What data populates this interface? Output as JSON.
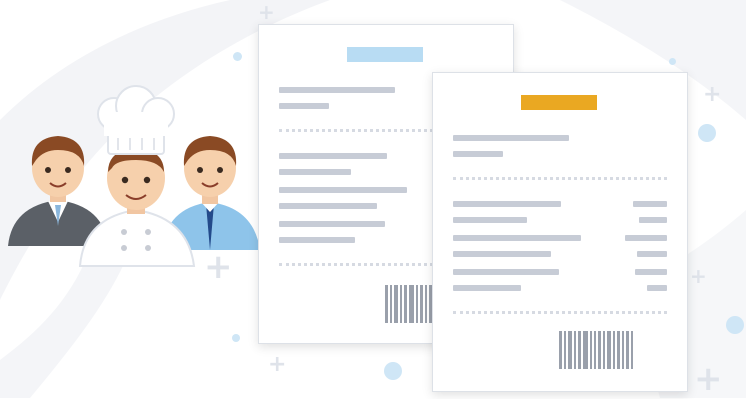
{
  "colors": {
    "back_header": "#b8dcf3",
    "front_header": "#eaa822",
    "line": "#c7ccd6",
    "barcode": "#9aa0ab",
    "bubble": "#cfe6f6",
    "plus": "#dfe3ea"
  },
  "illustration": {
    "people": [
      "manager",
      "chef",
      "waiter"
    ],
    "documents": [
      "receipt-back",
      "receipt-front"
    ]
  }
}
